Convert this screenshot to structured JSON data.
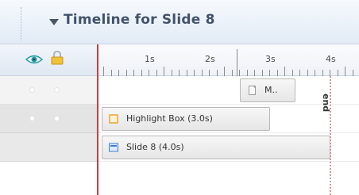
{
  "panel": {
    "title": "Timeline for Slide 8"
  },
  "ruler": {
    "ticks": [
      "1s",
      "2s",
      "3s",
      "4s"
    ]
  },
  "tracks": [
    {
      "label": "M..",
      "icon": "page-icon"
    },
    {
      "label": "Highlight Box (3.0s)",
      "icon": "highlight-box-icon"
    },
    {
      "label": "Slide 8 (4.0s)",
      "icon": "slide-icon"
    }
  ],
  "markers": {
    "end_label": "end"
  },
  "colors": {
    "playhead": "#d23a3a",
    "header_text": "#42526b",
    "highlight_icon": "#f0a43a",
    "slide_icon": "#3f7fcf",
    "eye_icon": "#2b9aa0",
    "lock_icon": "#e1a928"
  }
}
